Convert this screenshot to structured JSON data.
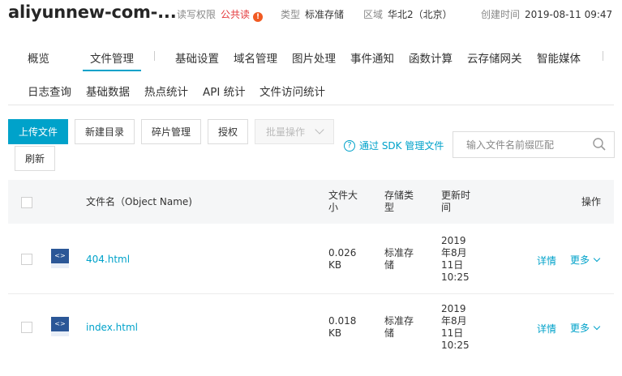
{
  "header": {
    "bucket_name": "aliyunnew-com-...",
    "acl_label": "读写权限",
    "acl_value": "公共读",
    "acl_warn": "!",
    "type_label": "类型",
    "type_value": "标准存储",
    "region_label": "区域",
    "region_value": "华北2（北京）",
    "created_label": "创建时间",
    "created_value": "2019-08-11 09:47"
  },
  "tabs": {
    "overview": "概览",
    "file_management": "文件管理",
    "basic_settings": "基础设置",
    "domain_management": "域名管理",
    "image_processing": "图片处理",
    "event_notification": "事件通知",
    "function_compute": "函数计算",
    "storage_gateway": "云存储网关",
    "smart_media": "智能媒体",
    "log_query": "日志查询",
    "basic_data": "基础数据",
    "hotspot_stats": "热点统计",
    "api_stats": "API 统计",
    "file_access_stats": "文件访问统计"
  },
  "toolbar": {
    "upload": "上传文件",
    "new_dir": "新建目录",
    "fragments": "碎片管理",
    "authorize": "授权",
    "batch": "批量操作",
    "refresh": "刷新",
    "sdk_link": "通过 SDK 管理文件",
    "search_placeholder": "输入文件名前缀匹配"
  },
  "table": {
    "headers": {
      "name": "文件名（Object Name)",
      "size": [
        "文件大",
        "小"
      ],
      "storage": [
        "存储类",
        "型"
      ],
      "updated": [
        "更新时",
        "间"
      ],
      "actions": "操作"
    },
    "rows": [
      {
        "name": "404.html",
        "size": [
          "0.026",
          "KB"
        ],
        "storage": [
          "标准存",
          "储"
        ],
        "updated": [
          "2019",
          "年8月",
          "11日",
          "10:25"
        ],
        "detail": "详情",
        "more": "更多"
      },
      {
        "name": "index.html",
        "size": [
          "0.018",
          "KB"
        ],
        "storage": [
          "标准存",
          "储"
        ],
        "updated": [
          "2019",
          "年8月",
          "11日",
          "10:25"
        ],
        "detail": "详情",
        "more": "更多"
      }
    ]
  },
  "colors": {
    "accent": "#00a2ca",
    "warn": "#e4393c",
    "file_icon": "#2b5797"
  }
}
